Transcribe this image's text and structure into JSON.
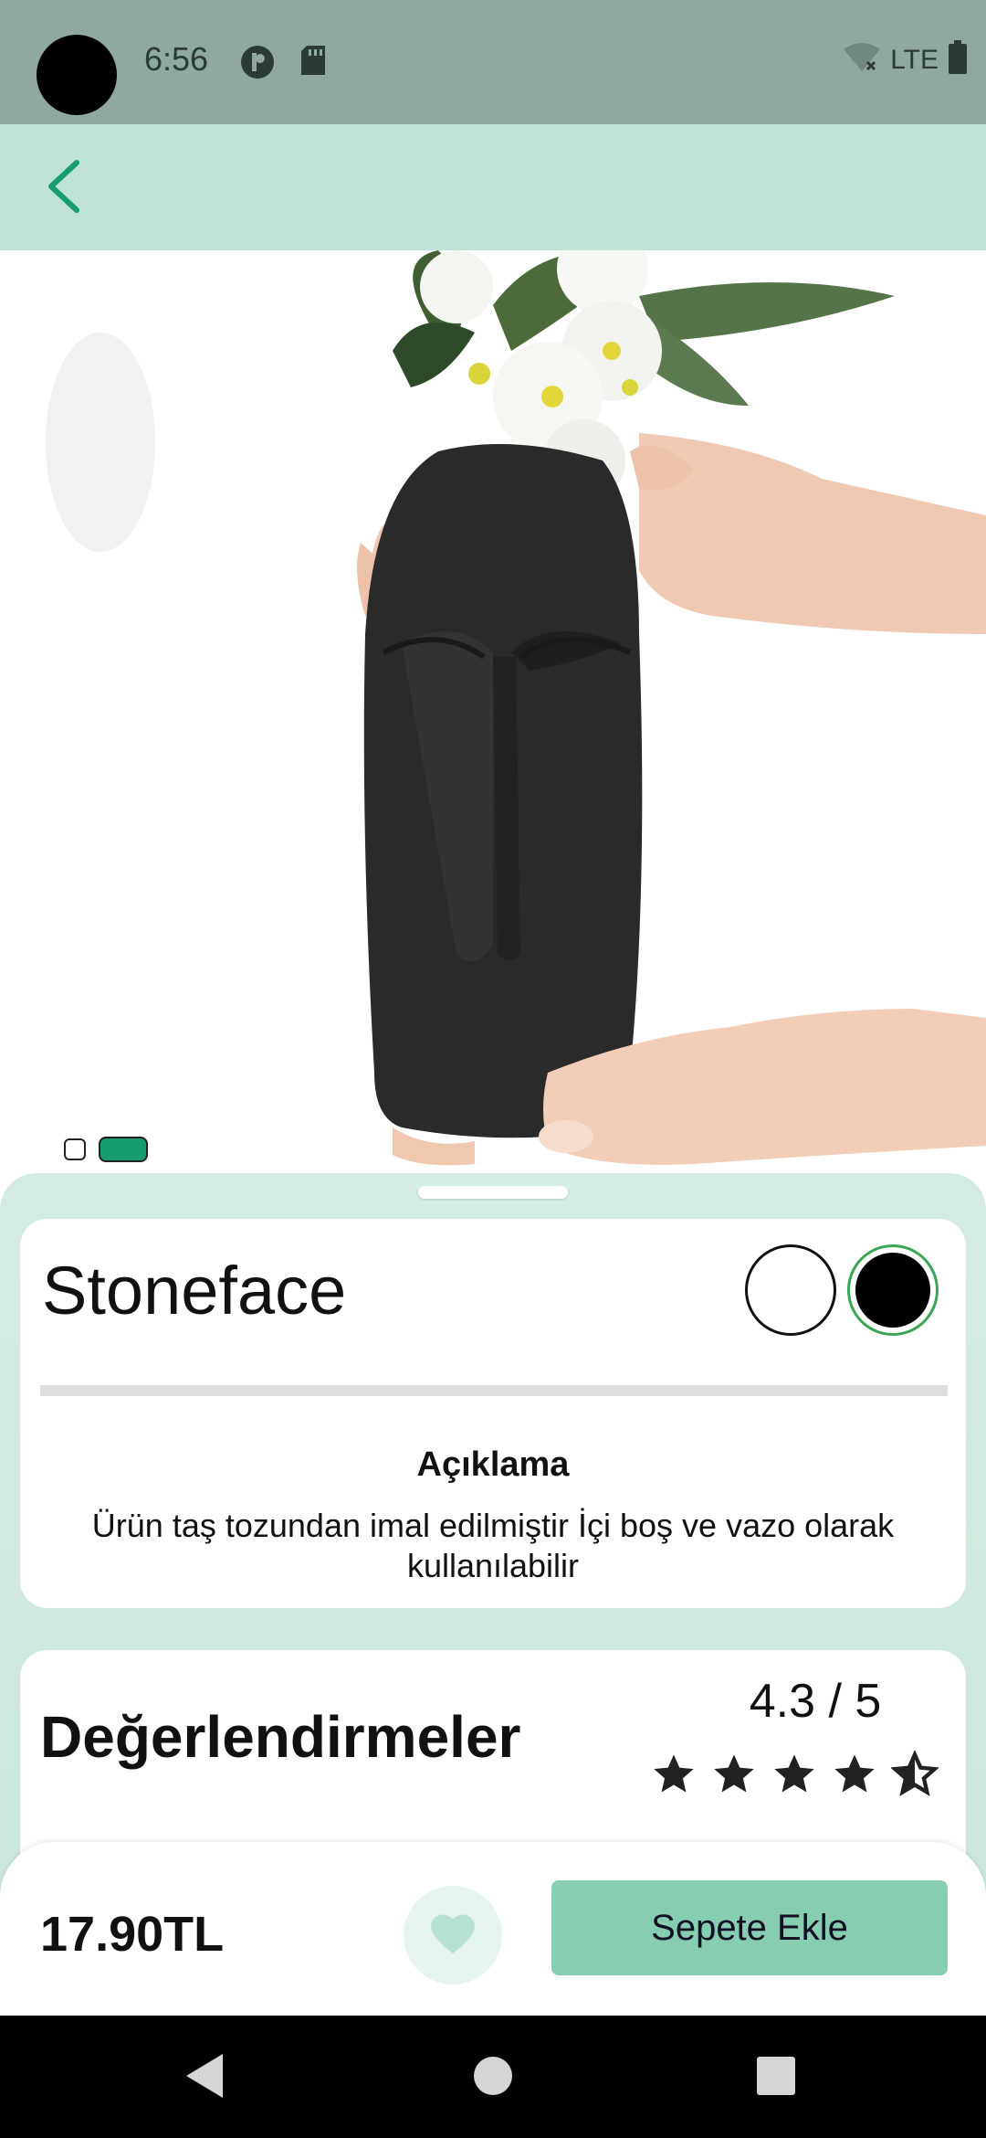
{
  "status_bar": {
    "time": "6:56",
    "network": "LTE"
  },
  "app_bar": {
    "back_icon": "chevron-left-icon"
  },
  "gallery": {
    "page_count": 2,
    "active_page": 2
  },
  "product": {
    "name": "Stoneface",
    "colors": [
      "#ffffff",
      "#000000"
    ],
    "selected_color": "#000000",
    "description_title": "Açıklama",
    "description": "Ürün taş tozundan imal edilmiştir İçi boş ve vazo olarak kullanılabilir"
  },
  "reviews": {
    "title": "Değerlendirmeler",
    "rating_text": "4.3 / 5",
    "rating": 4.3,
    "max_rating": 5
  },
  "action_bar": {
    "price": "17.90TL",
    "add_to_cart_label": "Sepete Ekle"
  },
  "colors": {
    "accent": "#169c6f",
    "app_bar": "#bfe4d7",
    "button": "#86cdb2"
  }
}
